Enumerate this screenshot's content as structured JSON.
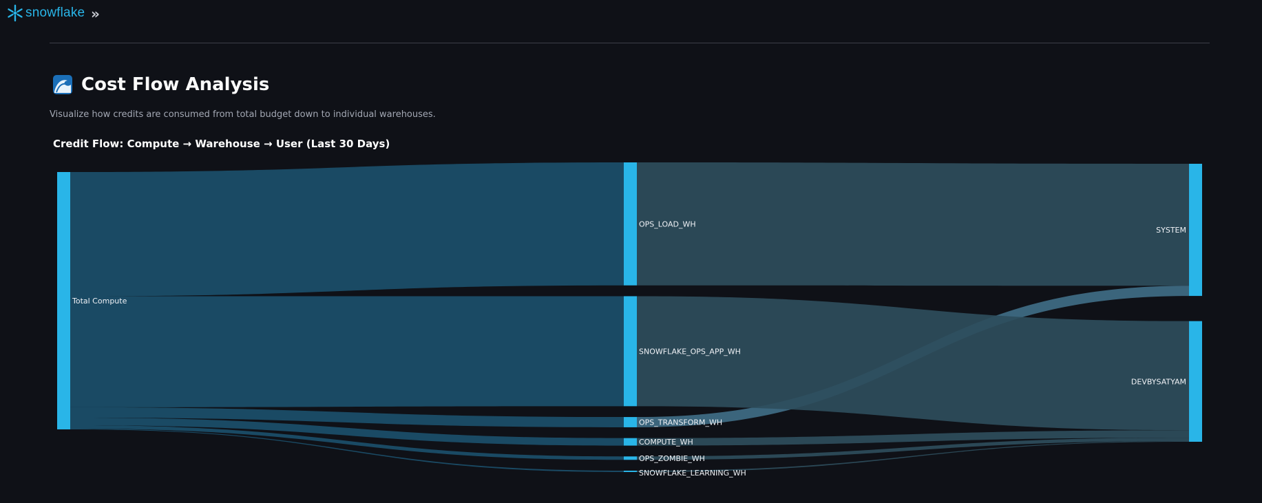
{
  "header": {
    "logo_text": "snowflake",
    "expand_icon": "double-chevron-right-icon"
  },
  "page": {
    "title_icon": "wave-icon",
    "title": "Cost Flow Analysis",
    "subtitle": "Visualize how credits are consumed from total budget down to individual warehouses."
  },
  "colors": {
    "background": "#0f1117",
    "node": "#29b5e8",
    "link_level1": "#1b4f6b",
    "link_level2": "#2e4d5c",
    "link_highlight": "#3f6c85"
  },
  "chart_data": {
    "type": "sankey",
    "title": "Credit Flow: Compute → Warehouse → User (Last 30 Days)",
    "nodes": [
      {
        "id": "total",
        "label": "Total Compute",
        "level": 0
      },
      {
        "id": "ops_load",
        "label": "OPS_LOAD_WH",
        "level": 1
      },
      {
        "id": "snow_app",
        "label": "SNOWFLAKE_OPS_APP_WH",
        "level": 1
      },
      {
        "id": "transform",
        "label": "OPS_TRANSFORM_WH",
        "level": 1
      },
      {
        "id": "compute",
        "label": "COMPUTE_WH",
        "level": 1
      },
      {
        "id": "zombie",
        "label": "OPS_ZOMBIE_WH",
        "level": 1
      },
      {
        "id": "learning",
        "label": "SNOWFLAKE_LEARNING_WH",
        "level": 1
      },
      {
        "id": "system",
        "label": "SYSTEM",
        "level": 2
      },
      {
        "id": "devby",
        "label": "DEVBYSATYAM",
        "level": 2
      }
    ],
    "links": [
      {
        "source": "total",
        "target": "ops_load",
        "value": 180
      },
      {
        "source": "total",
        "target": "snow_app",
        "value": 161
      },
      {
        "source": "total",
        "target": "transform",
        "value": 15
      },
      {
        "source": "total",
        "target": "compute",
        "value": 11
      },
      {
        "source": "total",
        "target": "zombie",
        "value": 5
      },
      {
        "source": "total",
        "target": "learning",
        "value": 1
      },
      {
        "source": "ops_load",
        "target": "system",
        "value": 180
      },
      {
        "source": "transform",
        "target": "system",
        "value": 15
      },
      {
        "source": "snow_app",
        "target": "devby",
        "value": 161
      },
      {
        "source": "compute",
        "target": "devby",
        "value": 11
      },
      {
        "source": "zombie",
        "target": "devby",
        "value": 5
      },
      {
        "source": "learning",
        "target": "devby",
        "value": 1
      }
    ]
  }
}
